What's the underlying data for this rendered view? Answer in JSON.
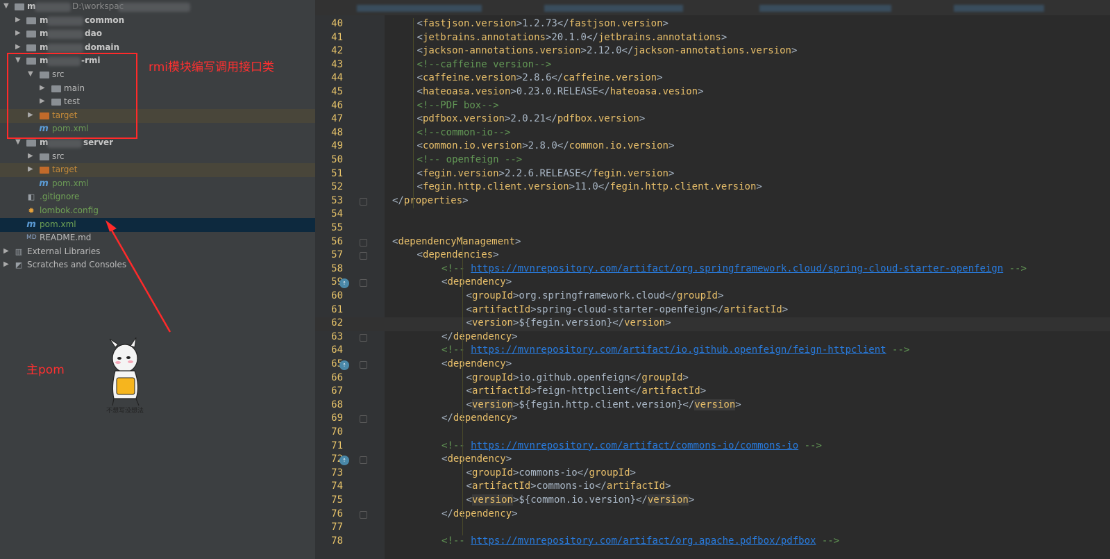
{
  "project_tree": {
    "root_label": "m",
    "root_path": "D:\\workspac",
    "items": [
      {
        "label": "common"
      },
      {
        "label": "dao"
      },
      {
        "label": "domain"
      },
      {
        "label": "-rmi"
      },
      {
        "label": "src"
      },
      {
        "label": "main"
      },
      {
        "label": "test"
      },
      {
        "label": "target"
      },
      {
        "label": "pom.xml"
      },
      {
        "label": "server"
      },
      {
        "label": "src"
      },
      {
        "label": "target"
      },
      {
        "label": "pom.xml"
      },
      {
        "label": ".gitignore"
      },
      {
        "label": "lombok.config"
      },
      {
        "label": "pom.xml"
      },
      {
        "label": "README.md"
      },
      {
        "label": "External Libraries"
      },
      {
        "label": "Scratches and Consoles"
      }
    ],
    "module_prefix": "m"
  },
  "annotations": {
    "rmi_note": "rmi模块编写调用接口类",
    "main_pom_note": "主pom",
    "sticker_caption": "不想写没想法"
  },
  "editor": {
    "lines": [
      {
        "n": "40",
        "a": "<",
        "t": "fastjson.version",
        "b": ">1.2.73</",
        "t2": "fastjson.version",
        "c": ">"
      },
      {
        "n": "41",
        "a": "<",
        "t": "jetbrains.annotations",
        "b": ">20.1.0</",
        "t2": "jetbrains.annotations",
        "c": ">"
      },
      {
        "n": "42",
        "a": "<",
        "t": "jackson-annotations.version",
        "b": ">2.12.0</",
        "t2": "jackson-annotations.version",
        "c": ">"
      },
      {
        "n": "43",
        "comment": "<!--caffeine version-->"
      },
      {
        "n": "44",
        "a": "<",
        "t": "caffeine.version",
        "b": ">2.8.6</",
        "t2": "caffeine.version",
        "c": ">"
      },
      {
        "n": "45",
        "a": "<",
        "t": "hateoasa.vesion",
        "b": ">0.23.0.RELEASE</",
        "t2": "hateoasa.vesion",
        "c": ">"
      },
      {
        "n": "46",
        "comment": "<!--PDF box-->"
      },
      {
        "n": "47",
        "a": "<",
        "t": "pdfbox.version",
        "b": ">2.0.21</",
        "t2": "pdfbox.version",
        "c": ">"
      },
      {
        "n": "48",
        "comment": "<!--common-io-->"
      },
      {
        "n": "49",
        "a": "<",
        "t": "common.io.version",
        "b": ">2.8.0</",
        "t2": "common.io.version",
        "c": ">"
      },
      {
        "n": "50",
        "comment": "<!-- openfeign -->"
      },
      {
        "n": "51",
        "a": "<",
        "t": "fegin.version",
        "b": ">2.2.6.RELEASE</",
        "t2": "fegin.version",
        "c": ">"
      },
      {
        "n": "52",
        "a": "<",
        "t": "fegin.http.client.version",
        "b": ">11.0</",
        "t2": "fegin.http.client.version",
        "c": ">"
      },
      {
        "n": "53",
        "a": "</",
        "t": "properties",
        "b": ">"
      },
      {
        "n": "54"
      },
      {
        "n": "55"
      },
      {
        "n": "56",
        "a": "<",
        "t": "dependencyManagement",
        "b": ">"
      },
      {
        "n": "57",
        "a": "<",
        "t": "dependencies",
        "b": ">"
      },
      {
        "n": "58",
        "cpre": "<!-- ",
        "url": "https://mvnrepository.com/artifact/org.springframework.cloud/spring-cloud-starter-openfeign",
        "cpost": " -->"
      },
      {
        "n": "59",
        "a": "<",
        "t": "dependency",
        "b": ">"
      },
      {
        "n": "60",
        "a": "<",
        "t": "groupId",
        "b": ">org.springframework.cloud</",
        "t2": "groupId",
        "c": ">"
      },
      {
        "n": "61",
        "a": "<",
        "t": "artifactId",
        "b": ">spring-cloud-starter-openfeign</",
        "t2": "artifactId",
        "c": ">"
      },
      {
        "n": "62",
        "a": "<",
        "t": "version",
        "b": ">${fegin.version}</",
        "t2": "version",
        "c": ">"
      },
      {
        "n": "63",
        "a": "</",
        "t": "dependency",
        "b": ">"
      },
      {
        "n": "64",
        "cpre": "<!-- ",
        "url": "https://mvnrepository.com/artifact/io.github.openfeign/feign-httpclient",
        "cpost": " -->"
      },
      {
        "n": "65",
        "a": "<",
        "t": "dependency",
        "b": ">"
      },
      {
        "n": "66",
        "a": "<",
        "t": "groupId",
        "b": ">io.github.openfeign</",
        "t2": "groupId",
        "c": ">"
      },
      {
        "n": "67",
        "a": "<",
        "t": "artifactId",
        "b": ">feign-httpclient</",
        "t2": "artifactId",
        "c": ">"
      },
      {
        "n": "68",
        "a": "<",
        "t": "version",
        "b": ">${fegin.http.client.version}</",
        "t2": "version",
        "c": ">"
      },
      {
        "n": "69",
        "a": "</",
        "t": "dependency",
        "b": ">"
      },
      {
        "n": "70"
      },
      {
        "n": "71",
        "cpre": "<!-- ",
        "url": "https://mvnrepository.com/artifact/commons-io/commons-io",
        "cpost": " -->"
      },
      {
        "n": "72",
        "a": "<",
        "t": "dependency",
        "b": ">"
      },
      {
        "n": "73",
        "a": "<",
        "t": "groupId",
        "b": ">commons-io</",
        "t2": "groupId",
        "c": ">"
      },
      {
        "n": "74",
        "a": "<",
        "t": "artifactId",
        "b": ">commons-io</",
        "t2": "artifactId",
        "c": ">"
      },
      {
        "n": "75",
        "a": "<",
        "t": "version",
        "b": ">${common.io.version}</",
        "t2": "version",
        "c": ">"
      },
      {
        "n": "76",
        "a": "</",
        "t": "dependency",
        "b": ">"
      },
      {
        "n": "77"
      },
      {
        "n": "78",
        "cpre": "<!-- ",
        "url": "https://mvnrepository.com/artifact/org.apache.pdfbox/pdfbox",
        "cpost": " -->"
      }
    ]
  },
  "colors": {
    "annotation_red": "#ff2a2a",
    "tag_yellow": "#e8bf6a",
    "comment_green": "#629755",
    "url_blue": "#287bde",
    "line_number": "#e8c46a"
  }
}
